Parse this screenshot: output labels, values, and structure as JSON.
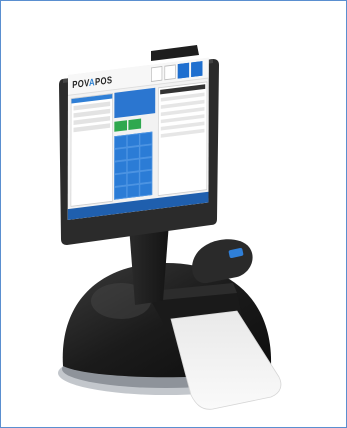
{
  "scene": {
    "description_colors": {
      "frame_border": "#5a8fd0",
      "tablet_body": "#2b2b2b",
      "stand": "#1c1c1c",
      "screen_accent": "#2b7cd6",
      "receipt_paper": "#f4f4f4",
      "base_ring": "#b8bcc2"
    }
  },
  "screen": {
    "logo_main": "POV",
    "logo_accent": "A",
    "logo_tail": "POS"
  }
}
